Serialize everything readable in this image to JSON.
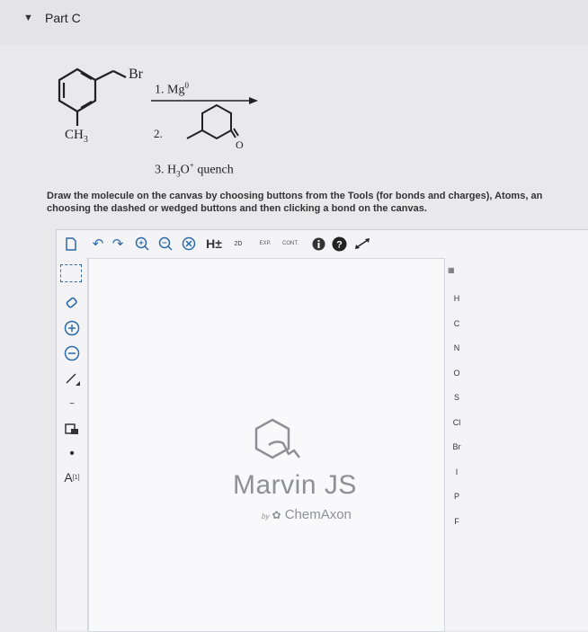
{
  "part": {
    "caret": "▼",
    "title": "Part C"
  },
  "scheme": {
    "substituent_br": "Br",
    "substituent_ch3": "CH",
    "ch3_subscript": "3",
    "step1": "1. Mg",
    "step1_sup": "0",
    "step2": "2.",
    "carbonyl_o": "O",
    "step3_prefix": "3. H",
    "step3_sub": "3",
    "step3_o": "O",
    "step3_sup": "+",
    "step3_suffix": "quench"
  },
  "instructions": {
    "line1": "Draw the molecule on the canvas by choosing buttons from the Tools (for bonds and charges), Atoms, an",
    "line2": "choosing the dashed or wedged buttons and then clicking a bond on the canvas."
  },
  "toolbar": {
    "h_toggle": "H±",
    "two_d": "2D",
    "exp": "EXP.",
    "cont": "CONT."
  },
  "leftbar": {
    "atom_label": "A",
    "atom_label_sup": "[1]"
  },
  "atoms": [
    "H",
    "C",
    "N",
    "O",
    "S",
    "Cl",
    "Br",
    "I",
    "P",
    "F"
  ],
  "watermark": {
    "title": "Marvin JS",
    "by": "by",
    "company": "ChemAxon"
  },
  "colors": {
    "accent": "#2b6aa8",
    "watermark": "#8f9096"
  }
}
